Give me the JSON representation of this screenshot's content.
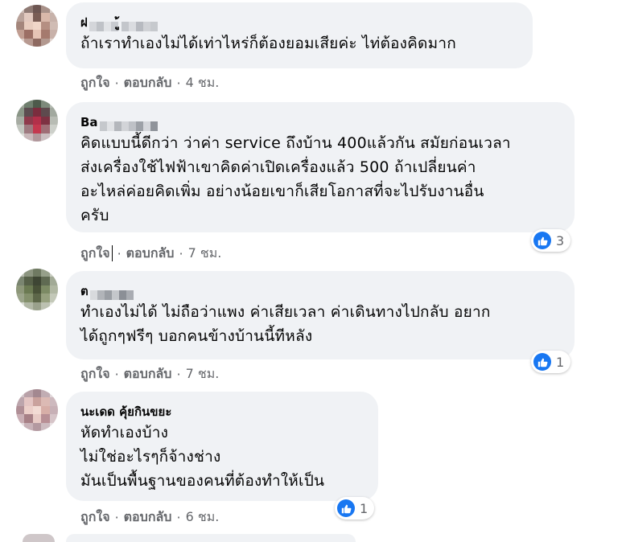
{
  "colors": {
    "bubble_bg": "#f0f2f5",
    "meta_text": "#65676b",
    "like_blue": "#1877f2"
  },
  "action_labels": {
    "like": "ถูกใจ",
    "reply": "ตอบกลับ",
    "separator": "·"
  },
  "comments": [
    {
      "author": "ฝ",
      "author_suffix": "ู้",
      "lines": [
        "ถ้าเราทำเองไม่ได้เท่าไหร่ก็ต้องยอมเสียค่ะ ไท่ต้องคิดมาก"
      ],
      "time": "4 ชม."
    },
    {
      "author": "Ba",
      "lines": [
        "คิดแบบนี้ดีกว่า ว่าค่า service ถึงบ้าน 400แล้วกัน สมัยก่อนเวลา",
        "ส่งเครื่องใช้ไฟฟ้าเขาคิดค่าเปิดเครื่องแล้ว 500 ถ้าเปลี่ยนค่า",
        "อะไหล่ค่อยคิดเพิ่ม อย่างน้อยเขาก็เสียโอกาสที่จะไปรับงานอื่น",
        "ครับ"
      ],
      "time": "7 ชม.",
      "reaction_count": "3"
    },
    {
      "author": "ต",
      "lines": [
        "ทำเองไม่ได้ ไม่ถือว่าแพง ค่าเสียเวลา ค่าเดินทางไปกลับ อยาก",
        "ได้ถูกๆฟรีๆ บอกคนข้างบ้านนี้ทีหลัง"
      ],
      "time": "7 ชม.",
      "reaction_count": "1"
    },
    {
      "author": "นะเดด คุ้ยกินขยะ",
      "lines": [
        "หัดทำเองบ้าง",
        "ไม่ใช่อะไรๆก็จ้างช่าง",
        "มันเป็นพื้นฐานของคนที่ต้องทำให้เป็น"
      ],
      "time": "6 ชม.",
      "reaction_count": "1"
    }
  ]
}
